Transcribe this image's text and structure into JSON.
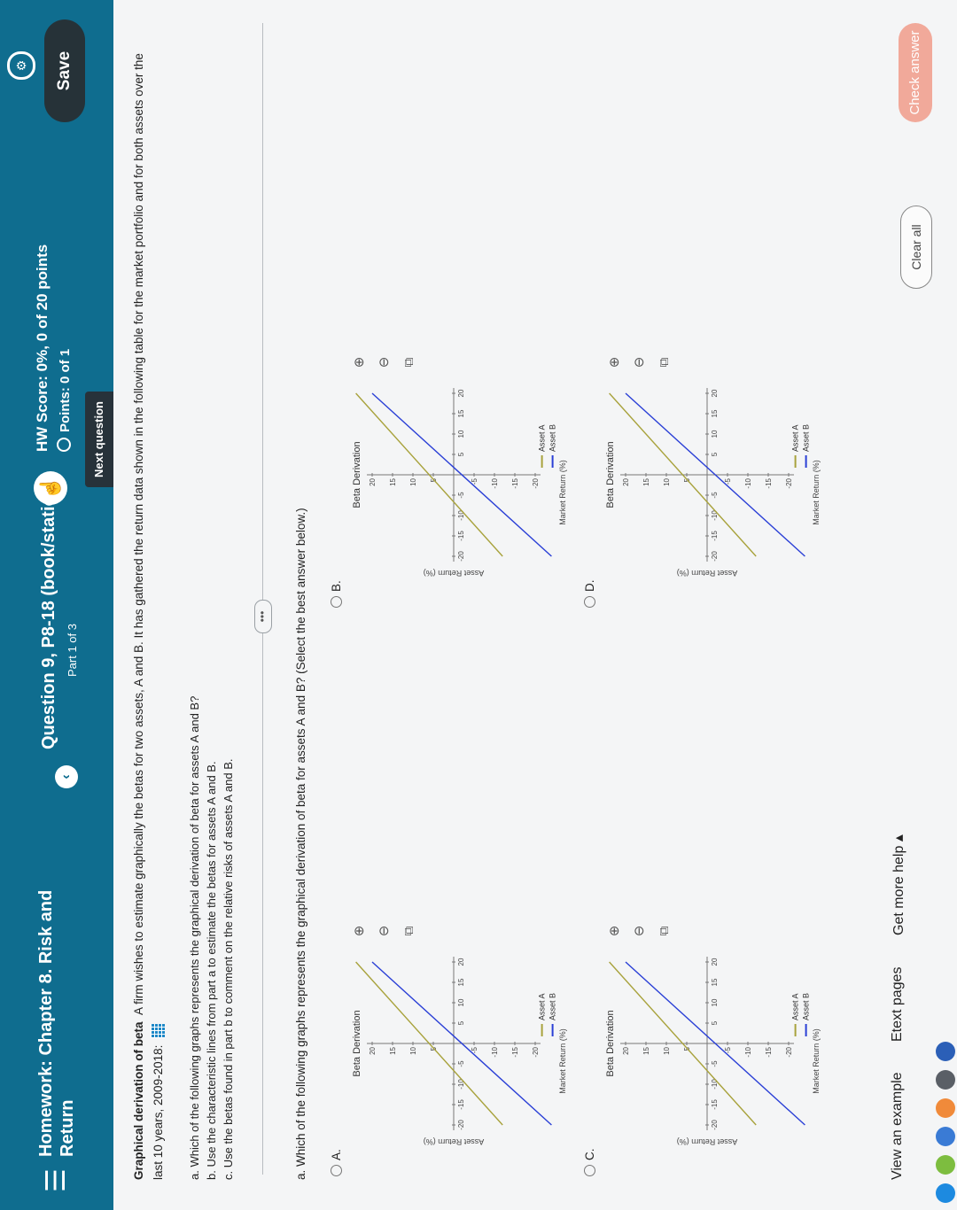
{
  "header": {
    "menu_glyph": "☰",
    "homework_title": "Homework: Chapter 8. Risk and Return",
    "question_title": "Question 9, P8-18 (book/static)",
    "question_part": "Part 1 of 3",
    "hw_score": "HW Score: 0%, 0 of 20 points",
    "points": "Points: 0 of 1",
    "next_question": "Next question",
    "save_label": "Save",
    "back_glyph": "‹",
    "accent_color": "#0f6d8f"
  },
  "question": {
    "title": "Graphical derivation of beta",
    "body": "A firm wishes to estimate graphically the betas for two assets, A and B. It has gathered the return data shown in the following table for the market portfolio and for both assets over the last 10 years, 2009-2018:",
    "parts": [
      "a.  Which of the following graphs represents the graphical derivation of beta for assets A and B?",
      "b.  Use the characteristic lines from part a to estimate the betas for assets A and B.",
      "c.  Use the betas found in part b to comment on the relative risks of assets A and B."
    ],
    "more_glyph": "•••",
    "prompt": "a. Which of the following graphs represents the graphical derivation of beta for assets A and B?  (Select the best answer below.)"
  },
  "options": [
    {
      "letter": "A.",
      "title": "Beta Derivation",
      "ylabel": "Asset Return (%)",
      "xlabel": "Market Return (%)",
      "legend_a": "Asset A",
      "legend_b": "Asset B"
    },
    {
      "letter": "B.",
      "title": "Beta Derivation",
      "ylabel": "Asset Return (%)",
      "xlabel": "Market Return (%)",
      "legend_a": "Asset A",
      "legend_b": "Asset B"
    },
    {
      "letter": "C.",
      "title": "Beta Derivation",
      "ylabel": "Asset Return (%)",
      "xlabel": "Market Return (%)",
      "legend_a": "Asset A",
      "legend_b": "Asset B"
    },
    {
      "letter": "D.",
      "title": "Beta Derivation",
      "ylabel": "Asset Return (%)",
      "xlabel": "Market Return (%)",
      "legend_a": "Asset A",
      "legend_b": "Asset B"
    }
  ],
  "axis": {
    "xticks": [
      "-20",
      "-15",
      "-10",
      "-5",
      "5",
      "10",
      "15",
      "20"
    ],
    "yticks_pos": [
      "20",
      "15",
      "10",
      "5"
    ],
    "yticks_neg": [
      "-5",
      "-10",
      "-15",
      "-20"
    ]
  },
  "colors": {
    "asset_a": "#a8a23c",
    "asset_b": "#2a3fd6"
  },
  "footer": {
    "view_example": "View an example",
    "etext": "Etext pages",
    "more_help": "Get more help ▴",
    "clear_all": "Clear all",
    "check_answer": "Check answer"
  }
}
